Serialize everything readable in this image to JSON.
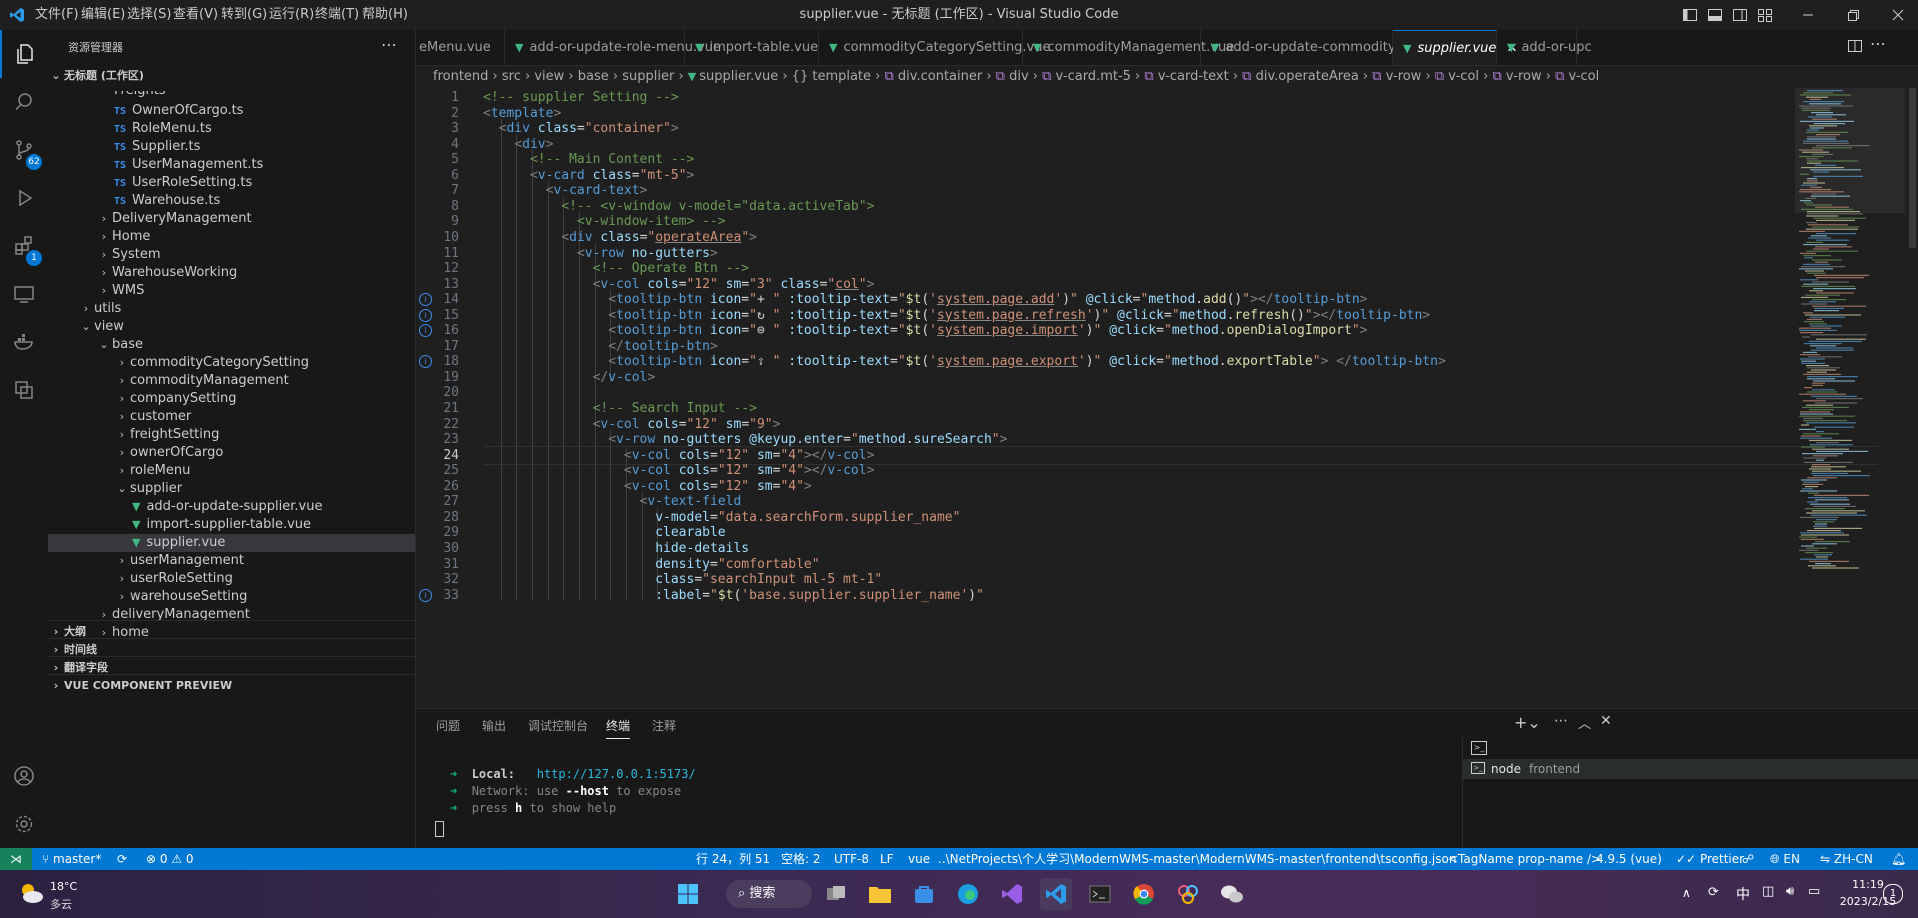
{
  "titlebar": {
    "title": "supplier.vue - 无标题 (工作区) - Visual Studio Code",
    "menu": [
      "文件(F)",
      "编辑(E)",
      "选择(S)",
      "查看(V)",
      "转到(G)",
      "运行(R)",
      "终端(T)",
      "帮助(H)"
    ]
  },
  "activity": {
    "source_control_badge": "62",
    "extensions_badge": "1"
  },
  "sidebar": {
    "header": "资源管理器",
    "workspace": "无标题 (工作区)",
    "items": [
      {
        "label": "Freights",
        "kind": "partial",
        "indent": 1
      },
      {
        "label": "OwnerOfCargo.ts",
        "kind": "ts",
        "indent": 2
      },
      {
        "label": "RoleMenu.ts",
        "kind": "ts",
        "indent": 2
      },
      {
        "label": "Supplier.ts",
        "kind": "ts",
        "indent": 2
      },
      {
        "label": "UserManagement.ts",
        "kind": "ts",
        "indent": 2
      },
      {
        "label": "UserRoleSetting.ts",
        "kind": "ts",
        "indent": 2
      },
      {
        "label": "Warehouse.ts",
        "kind": "ts",
        "indent": 2
      },
      {
        "label": "DeliveryManagement",
        "kind": "folder",
        "indent": 1
      },
      {
        "label": "Home",
        "kind": "folder",
        "indent": 1
      },
      {
        "label": "System",
        "kind": "folder",
        "indent": 1
      },
      {
        "label": "WarehouseWorking",
        "kind": "folder",
        "indent": 1
      },
      {
        "label": "WMS",
        "kind": "folder",
        "indent": 1
      },
      {
        "label": "utils",
        "kind": "folder",
        "indent": 0
      },
      {
        "label": "view",
        "kind": "open",
        "indent": 0
      },
      {
        "label": "base",
        "kind": "open",
        "indent": 1
      },
      {
        "label": "commodityCategorySetting",
        "kind": "folder",
        "indent": 2
      },
      {
        "label": "commodityManagement",
        "kind": "folder",
        "indent": 2
      },
      {
        "label": "companySetting",
        "kind": "folder",
        "indent": 2
      },
      {
        "label": "customer",
        "kind": "folder",
        "indent": 2
      },
      {
        "label": "freightSetting",
        "kind": "folder",
        "indent": 2
      },
      {
        "label": "ownerOfCargo",
        "kind": "folder",
        "indent": 2
      },
      {
        "label": "roleMenu",
        "kind": "folder",
        "indent": 2
      },
      {
        "label": "supplier",
        "kind": "open",
        "indent": 2
      },
      {
        "label": "add-or-update-supplier.vue",
        "kind": "vue",
        "indent": 3
      },
      {
        "label": "import-supplier-table.vue",
        "kind": "vue",
        "indent": 3
      },
      {
        "label": "supplier.vue",
        "kind": "vue",
        "indent": 3,
        "selected": true
      },
      {
        "label": "userManagement",
        "kind": "folder",
        "indent": 2
      },
      {
        "label": "userRoleSetting",
        "kind": "folder",
        "indent": 2
      },
      {
        "label": "warehouseSetting",
        "kind": "folder",
        "indent": 2
      },
      {
        "label": "deliveryManagement",
        "kind": "folder",
        "indent": 1
      },
      {
        "label": "home",
        "kind": "folder",
        "indent": 1
      }
    ],
    "sections": [
      "大纲",
      "时间线",
      "翻译字段",
      "VUE COMPONENT PREVIEW"
    ]
  },
  "tabs": [
    {
      "label": "eMenu.vue",
      "icon": false
    },
    {
      "label": "add-or-update-role-menu.vue",
      "icon": true
    },
    {
      "label": "import-table.vue",
      "icon": true
    },
    {
      "label": "commodityCategorySetting.vue",
      "icon": true
    },
    {
      "label": "commodityManagement.vue",
      "icon": true
    },
    {
      "label": "add-or-update-commodity.vue",
      "icon": true
    },
    {
      "label": "supplier.vue",
      "icon": true,
      "active": true
    },
    {
      "label": "add-or-upc",
      "icon": true
    }
  ],
  "breadcrumb": [
    "frontend",
    "src",
    "view",
    "base",
    "supplier",
    "supplier.vue",
    "{} template",
    "div.container",
    "div",
    "v-card.mt-5",
    "v-card-text",
    "div.operateArea",
    "v-row",
    "v-col",
    "v-row",
    "v-col"
  ],
  "editor": {
    "current_line": 24,
    "lines": [
      {
        "n": "1",
        "html": "<span class='cm'>&lt;!-- supplier Setting --&gt;</span>"
      },
      {
        "n": "2",
        "html": "<span class='tg'>&lt;</span><span class='tn'>template</span><span class='tg'>&gt;</span>"
      },
      {
        "n": "3",
        "html": "  <span class='tg'>&lt;</span><span class='tn'>div</span> <span class='at'>class</span>=<span class='st'>\"container\"</span><span class='tg'>&gt;</span>"
      },
      {
        "n": "4",
        "html": "    <span class='tg'>&lt;</span><span class='tn'>div</span><span class='tg'>&gt;</span>"
      },
      {
        "n": "5",
        "html": "      <span class='cm'>&lt;!-- Main Content --&gt;</span>"
      },
      {
        "n": "6",
        "html": "      <span class='tg'>&lt;</span><span class='tn'>v-card</span> <span class='at'>class</span>=<span class='st'>\"mt-5\"</span><span class='tg'>&gt;</span>"
      },
      {
        "n": "7",
        "html": "        <span class='tg'>&lt;</span><span class='tn'>v-card-text</span><span class='tg'>&gt;</span>"
      },
      {
        "n": "8",
        "html": "          <span class='cm'>&lt;!-- &lt;v-window v-model=\"data.activeTab\"&gt;</span>"
      },
      {
        "n": "9",
        "html": "<span class='cm'>            &lt;v-window-item&gt; --&gt;</span>"
      },
      {
        "n": "10",
        "html": "          <span class='tg'>&lt;</span><span class='tn'>div</span> <span class='at'>class</span>=<span class='st'>\"<span class='ul'>operateArea</span>\"</span><span class='tg'>&gt;</span>"
      },
      {
        "n": "11",
        "html": "            <span class='tg'>&lt;</span><span class='tn'>v-row</span> <span class='at'>no-gutters</span><span class='tg'>&gt;</span>"
      },
      {
        "n": "12",
        "html": "              <span class='cm'>&lt;!-- Operate Btn --&gt;</span>"
      },
      {
        "n": "13",
        "html": "              <span class='tg'>&lt;</span><span class='tn'>v-col</span> <span class='at'>cols</span>=<span class='st'>\"12\"</span> <span class='at'>sm</span>=<span class='st'>\"3\"</span> <span class='at'>class</span>=<span class='st'>\"<span class='ul'>col</span>\"</span><span class='tg'>&gt;</span>"
      },
      {
        "n": "14",
        "info": true,
        "html": "                <span class='tg'>&lt;</span><span class='tn'>tooltip-btn</span> <span class='at'>icon</span>=<span class='st'>\"</span><span class='df'>+</span> <span class='st'>\"</span> <span class='at'>:tooltip-text</span>=<span class='st'>\"</span><span class='ev'>$t</span><span class='df'>(</span><span class='st'>'<span class='ul'>system.page.add</span>'</span><span class='df'>)</span><span class='st'>\"</span> <span class='at'>@click</span>=<span class='st'>\"</span><span class='at'>method</span><span class='df'>.</span><span class='ev'>add</span><span class='df'>()</span><span class='st'>\"</span><span class='tg'>&gt;&lt;/</span><span class='tn'>tooltip-btn</span><span class='tg'>&gt;</span>"
      },
      {
        "n": "15",
        "info": true,
        "html": "                <span class='tg'>&lt;</span><span class='tn'>tooltip-btn</span> <span class='at'>icon</span>=<span class='st'>\"</span><span class='df'>↻</span> <span class='st'>\"</span> <span class='at'>:tooltip-text</span>=<span class='st'>\"</span><span class='ev'>$t</span><span class='df'>(</span><span class='st'>'<span class='ul'>system.page.refresh</span>'</span><span class='df'>)</span><span class='st'>\"</span> <span class='at'>@click</span>=<span class='st'>\"</span><span class='at'>method</span><span class='df'>.</span><span class='ev'>refresh</span><span class='df'>()</span><span class='st'>\"</span><span class='tg'>&gt;&lt;/</span><span class='tn'>tooltip-btn</span><span class='tg'>&gt;</span>"
      },
      {
        "n": "16",
        "info": true,
        "html": "                <span class='tg'>&lt;</span><span class='tn'>tooltip-btn</span> <span class='at'>icon</span>=<span class='st'>\"</span><span class='df'>⊜</span> <span class='st'>\"</span> <span class='at'>:tooltip-text</span>=<span class='st'>\"</span><span class='ev'>$t</span><span class='df'>(</span><span class='st'>'<span class='ul'>system.page.import</span>'</span><span class='df'>)</span><span class='st'>\"</span> <span class='at'>@click</span>=<span class='st'>\"</span><span class='at'>method</span><span class='df'>.</span><span class='ev'>openDialogImport</span><span class='st'>\"</span><span class='tg'>&gt;</span>"
      },
      {
        "n": "17",
        "html": "                <span class='tg'>&lt;/</span><span class='tn'>tooltip-btn</span><span class='tg'>&gt;</span>"
      },
      {
        "n": "18",
        "info": true,
        "html": "                <span class='tg'>&lt;</span><span class='tn'>tooltip-btn</span> <span class='at'>icon</span>=<span class='st'>\"</span><span class='df'>⇪</span> <span class='st'>\"</span> <span class='at'>:tooltip-text</span>=<span class='st'>\"</span><span class='ev'>$t</span><span class='df'>(</span><span class='st'>'<span class='ul'>system.page.export</span>'</span><span class='df'>)</span><span class='st'>\"</span> <span class='at'>@click</span>=<span class='st'>\"</span><span class='at'>method</span><span class='df'>.</span><span class='ev'>exportTable</span><span class='st'>\"</span><span class='tg'>&gt;</span> <span class='tg'>&lt;/</span><span class='tn'>tooltip-btn</span><span class='tg'>&gt;</span>"
      },
      {
        "n": "19",
        "html": "              <span class='tg'>&lt;/</span><span class='tn'>v-col</span><span class='tg'>&gt;</span>"
      },
      {
        "n": "20",
        "html": ""
      },
      {
        "n": "21",
        "html": "              <span class='cm'>&lt;!-- Search Input --&gt;</span>"
      },
      {
        "n": "22",
        "html": "              <span class='tg'>&lt;</span><span class='tn'>v-col</span> <span class='at'>cols</span>=<span class='st'>\"12\"</span> <span class='at'>sm</span>=<span class='st'>\"9\"</span><span class='tg'>&gt;</span>"
      },
      {
        "n": "23",
        "html": "                <span class='tg'>&lt;</span><span class='tn'>v-row</span> <span class='at'>no-gutters</span> <span class='at'>@keyup.enter</span>=<span class='st'>\"</span><span class='at'>method</span><span class='df'>.</span><span class='at'>sureSearch</span><span class='st'>\"</span><span class='tg'>&gt;</span>"
      },
      {
        "n": "24",
        "html": "                  <span class='tg'>&lt;</span><span class='tn'>v-col</span> <span class='at'>cols</span>=<span class='st'>\"12\"</span> <span class='at'>sm</span>=<span class='st'>\"4\"</span><span class='tg'>&gt;&lt;/</span><span class='tn'>v-col</span><span class='tg'>&gt;</span>"
      },
      {
        "n": "25",
        "html": "                  <span class='tg'>&lt;</span><span class='tn'>v-col</span> <span class='at'>cols</span>=<span class='st'>\"12\"</span> <span class='at'>sm</span>=<span class='st'>\"4\"</span><span class='tg'>&gt;&lt;/</span><span class='tn'>v-col</span><span class='tg'>&gt;</span>"
      },
      {
        "n": "26",
        "html": "                  <span class='tg'>&lt;</span><span class='tn'>v-col</span> <span class='at'>cols</span>=<span class='st'>\"12\"</span> <span class='at'>sm</span>=<span class='st'>\"4\"</span><span class='tg'>&gt;</span>"
      },
      {
        "n": "27",
        "html": "                    <span class='tg'>&lt;</span><span class='tn'>v-text-field</span>"
      },
      {
        "n": "28",
        "html": "                      <span class='at'>v-model</span>=<span class='st'>\"data.searchForm.supplier_name\"</span>"
      },
      {
        "n": "29",
        "html": "                      <span class='at'>clearable</span>"
      },
      {
        "n": "30",
        "html": "                      <span class='at'>hide-details</span>"
      },
      {
        "n": "31",
        "html": "                      <span class='at'>density</span>=<span class='st'>\"comfortable\"</span>"
      },
      {
        "n": "32",
        "html": "                      <span class='at'>class</span>=<span class='st'>\"searchInput ml-5 mt-1\"</span>"
      },
      {
        "n": "33",
        "info": true,
        "html": "                      <span class='at'>:label</span>=<span class='st'>\"</span><span class='ev'>$t</span><span class='df'>(</span><span class='st'>'base.supplier.supplier_name'</span><span class='df'>)</span><span class='st'>\"</span>"
      }
    ]
  },
  "panel": {
    "tabs": [
      "问题",
      "输出",
      "调试控制台",
      "终端",
      "注释"
    ],
    "active_tab": "终端",
    "terminal": {
      "local_label": "Local:",
      "local_url": "http://127.0.0.1:5173/",
      "network_label": "Network:",
      "network_pre": "use ",
      "network_flag": "--host",
      "network_post": " to expose",
      "help_pre": "press ",
      "help_key": "h",
      "help_post": " to show help"
    },
    "terminal_list": {
      "name": "node",
      "folder": "frontend"
    }
  },
  "statusbar": {
    "branch": "master*",
    "errors": "0",
    "warnings": "0",
    "position": "行 24，列 51",
    "spaces": "空格: 2",
    "encoding": "UTF-8",
    "eol": "LF",
    "language": "vue",
    "tsconfig": "..\\NetProjects\\个人学习\\ModernWMS-master\\ModernWMS-master\\frontend\\tsconfig.json",
    "tag": "<TagName prop-name />",
    "version": "4.9.5 (vue)",
    "prettier": "Prettier",
    "lang_en": "EN",
    "lang_zh": "ZH-CN"
  },
  "taskbar": {
    "temp": "18°C",
    "weather": "多云",
    "search": "搜索",
    "ime": "中",
    "time": "11:19",
    "date": "2023/2/15",
    "notify": "1"
  },
  "colors": {
    "accent": "#0078d4",
    "vue": "#41b883",
    "ts": "#3b8eea"
  }
}
